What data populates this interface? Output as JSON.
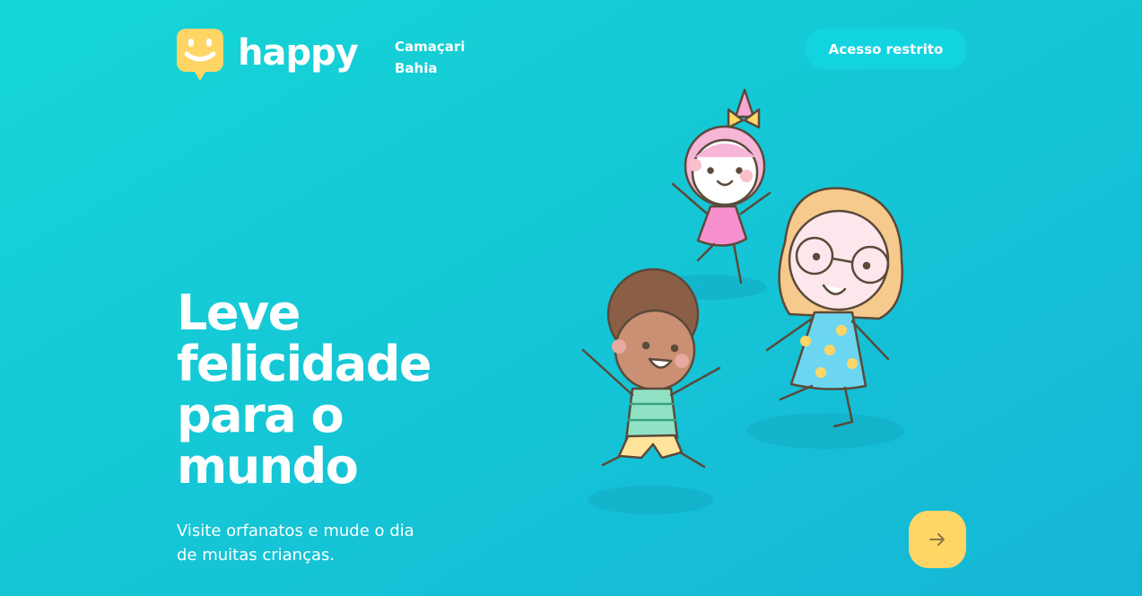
{
  "brand": {
    "name": "happy",
    "icon": "smile-chat-icon"
  },
  "location": {
    "city": "Camaçari",
    "state": "Bahia"
  },
  "header": {
    "restricted_label": "Acesso restrito"
  },
  "hero": {
    "title_lines": [
      "Leve",
      "felicidade",
      "para o",
      "mundo"
    ],
    "subtitle": "Visite orfanatos e mude o dia de muitas crianças."
  },
  "enter_button": {
    "icon": "arrow-right-icon"
  },
  "colors": {
    "background": "#15c3d6",
    "accent": "#ffd666",
    "button": "#12d4e0"
  }
}
